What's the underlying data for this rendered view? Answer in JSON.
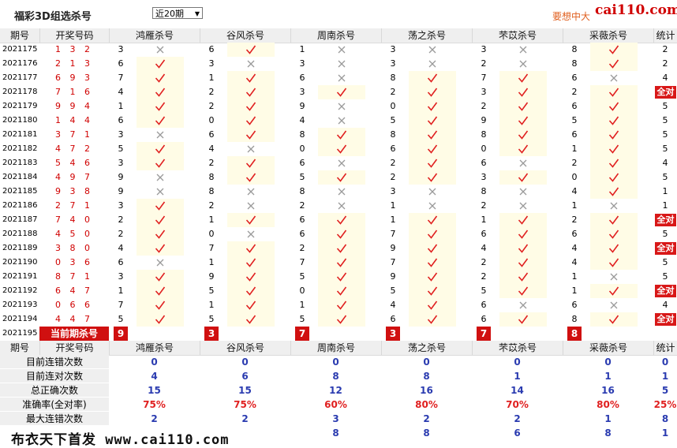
{
  "title": "福彩3D组选杀号",
  "period_select": "近20期",
  "promo_text": "要想中大",
  "site_logo": "cai110.com",
  "watermark": "布衣天下首发 www.cai110.com",
  "headers": {
    "period": "期号",
    "draw": "开奖号码",
    "experts": [
      "鸿雁杀号",
      "谷风杀号",
      "周南杀号",
      "荡之杀号",
      "芣苡杀号",
      "采薇杀号"
    ],
    "tally": "统计"
  },
  "rows": [
    {
      "period": "2021175",
      "draw": "1 3 2",
      "kills": [
        3,
        6,
        1,
        3,
        3,
        8
      ],
      "hits": [
        0,
        1,
        0,
        0,
        0,
        1
      ],
      "tally": "2"
    },
    {
      "period": "2021176",
      "draw": "2 1 3",
      "kills": [
        6,
        3,
        3,
        3,
        2,
        8
      ],
      "hits": [
        1,
        0,
        0,
        0,
        0,
        1
      ],
      "tally": "2"
    },
    {
      "period": "2021177",
      "draw": "6 9 3",
      "kills": [
        7,
        1,
        6,
        8,
        7,
        6
      ],
      "hits": [
        1,
        1,
        0,
        1,
        1,
        0
      ],
      "tally": "4"
    },
    {
      "period": "2021178",
      "draw": "7 1 6",
      "kills": [
        4,
        2,
        3,
        2,
        3,
        2
      ],
      "hits": [
        1,
        1,
        1,
        1,
        1,
        1
      ],
      "tally": "全对"
    },
    {
      "period": "2021179",
      "draw": "9 9 4",
      "kills": [
        1,
        2,
        9,
        0,
        2,
        6
      ],
      "hits": [
        1,
        1,
        0,
        1,
        1,
        1
      ],
      "tally": "5"
    },
    {
      "period": "2021180",
      "draw": "1 4 4",
      "kills": [
        6,
        0,
        4,
        5,
        9,
        5
      ],
      "hits": [
        1,
        1,
        0,
        1,
        1,
        1
      ],
      "tally": "5"
    },
    {
      "period": "2021181",
      "draw": "3 7 1",
      "kills": [
        3,
        6,
        8,
        8,
        8,
        6
      ],
      "hits": [
        0,
        1,
        1,
        1,
        1,
        1
      ],
      "tally": "5"
    },
    {
      "period": "2021182",
      "draw": "4 7 2",
      "kills": [
        5,
        4,
        0,
        6,
        0,
        1
      ],
      "hits": [
        1,
        0,
        1,
        1,
        1,
        1
      ],
      "tally": "5"
    },
    {
      "period": "2021183",
      "draw": "5 4 6",
      "kills": [
        3,
        2,
        6,
        2,
        6,
        2
      ],
      "hits": [
        1,
        1,
        0,
        1,
        0,
        1
      ],
      "tally": "4"
    },
    {
      "period": "2021184",
      "draw": "4 9 7",
      "kills": [
        9,
        8,
        5,
        2,
        3,
        0
      ],
      "hits": [
        0,
        1,
        1,
        1,
        1,
        1
      ],
      "tally": "5"
    },
    {
      "period": "2021185",
      "draw": "9 3 8",
      "kills": [
        9,
        8,
        8,
        3,
        8,
        4
      ],
      "hits": [
        0,
        0,
        0,
        0,
        0,
        1
      ],
      "tally": "1"
    },
    {
      "period": "2021186",
      "draw": "2 7 1",
      "kills": [
        3,
        2,
        2,
        1,
        2,
        1
      ],
      "hits": [
        1,
        0,
        0,
        0,
        0,
        0
      ],
      "tally": "1"
    },
    {
      "period": "2021187",
      "draw": "7 4 0",
      "kills": [
        2,
        1,
        6,
        1,
        1,
        2
      ],
      "hits": [
        1,
        1,
        1,
        1,
        1,
        1
      ],
      "tally": "全对"
    },
    {
      "period": "2021188",
      "draw": "4 5 0",
      "kills": [
        2,
        0,
        6,
        7,
        6,
        6
      ],
      "hits": [
        1,
        0,
        1,
        1,
        1,
        1
      ],
      "tally": "5"
    },
    {
      "period": "2021189",
      "draw": "3 8 0",
      "kills": [
        4,
        7,
        2,
        9,
        4,
        4
      ],
      "hits": [
        1,
        1,
        1,
        1,
        1,
        1
      ],
      "tally": "全对"
    },
    {
      "period": "2021190",
      "draw": "0 3 6",
      "kills": [
        6,
        1,
        7,
        7,
        2,
        4
      ],
      "hits": [
        0,
        1,
        1,
        1,
        1,
        1
      ],
      "tally": "5"
    },
    {
      "period": "2021191",
      "draw": "8 7 1",
      "kills": [
        3,
        9,
        5,
        9,
        2,
        1
      ],
      "hits": [
        1,
        1,
        1,
        1,
        1,
        0
      ],
      "tally": "5"
    },
    {
      "period": "2021192",
      "draw": "6 4 7",
      "kills": [
        1,
        5,
        0,
        5,
        5,
        1
      ],
      "hits": [
        1,
        1,
        1,
        1,
        1,
        1
      ],
      "tally": "全对"
    },
    {
      "period": "2021193",
      "draw": "0 6 6",
      "kills": [
        7,
        1,
        1,
        4,
        6,
        6
      ],
      "hits": [
        1,
        1,
        1,
        1,
        0,
        0
      ],
      "tally": "4"
    },
    {
      "period": "2021194",
      "draw": "4 4 7",
      "kills": [
        5,
        5,
        5,
        6,
        6,
        8
      ],
      "hits": [
        1,
        1,
        1,
        1,
        1,
        1
      ],
      "tally": "全对"
    }
  ],
  "current": {
    "period": "2021195",
    "label": "当前期杀号",
    "kills": [
      "9",
      "3",
      "7",
      "3",
      "7",
      "8"
    ]
  },
  "stats": [
    {
      "label": "目前连错次数",
      "values": [
        "0",
        "0",
        "0",
        "0",
        "0",
        "0",
        "0"
      ],
      "red": false
    },
    {
      "label": "目前连对次数",
      "values": [
        "4",
        "6",
        "8",
        "8",
        "1",
        "1",
        "1"
      ],
      "red": false
    },
    {
      "label": "总正确次数",
      "values": [
        "15",
        "15",
        "12",
        "16",
        "14",
        "16",
        "5"
      ],
      "red": false
    },
    {
      "label": "准确率(全对率)",
      "values": [
        "75%",
        "75%",
        "60%",
        "80%",
        "70%",
        "80%",
        "25%"
      ],
      "red": true
    },
    {
      "label": "最大连错次数",
      "values": [
        "2",
        "2",
        "3",
        "2",
        "2",
        "1",
        "8"
      ],
      "red": false
    },
    {
      "label": "",
      "values": [
        "",
        "",
        "8",
        "8",
        "6",
        "8",
        "1"
      ],
      "red": false
    }
  ],
  "colors": {
    "accent_red": "#d01010",
    "check": "#e02020",
    "cross": "#9a9a9a",
    "stat_blue": "#2a3bb0",
    "highlight": "#fffce6"
  }
}
